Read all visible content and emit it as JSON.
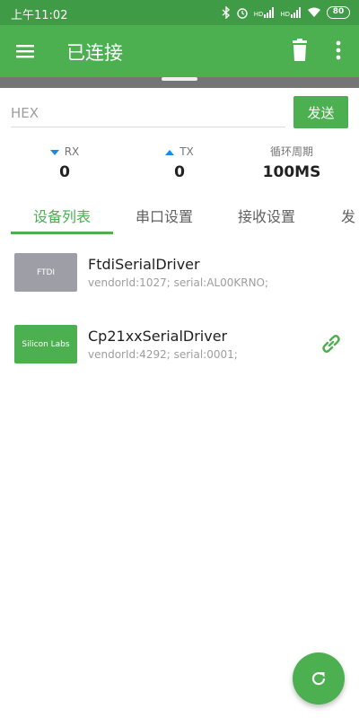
{
  "status_bar": {
    "time": "上午11:02",
    "battery": "80",
    "net_hd1": "HD",
    "net_hd2": "HD"
  },
  "app_bar": {
    "title": "已连接",
    "menu_icon": "menu-icon",
    "trash_icon": "trash-icon",
    "more_icon": "more-vert-icon"
  },
  "input": {
    "placeholder": "HEX",
    "value": "",
    "send_label": "发送"
  },
  "stats": {
    "rx_label": "RX",
    "rx_value": "0",
    "tx_label": "TX",
    "tx_value": "0",
    "period_label": "循环周期",
    "period_value": "100MS"
  },
  "tabs": [
    {
      "label": "设备列表",
      "active": true
    },
    {
      "label": "串口设置",
      "active": false
    },
    {
      "label": "接收设置",
      "active": false
    },
    {
      "label": "发",
      "active": false
    }
  ],
  "devices": [
    {
      "logo_text": "FTDI",
      "name": "FtdiSerialDriver",
      "info": "vendorId:1027; serial:AL00KRNO;",
      "logo_color": "#9e9ea6",
      "connected": false
    },
    {
      "logo_text": "Silicon Labs",
      "name": "Cp21xxSerialDriver",
      "info": "vendorId:4292; serial:0001;",
      "logo_color": "#4caf50",
      "connected": true,
      "link_icon": "link-icon"
    }
  ],
  "fab": {
    "icon": "refresh-icon"
  },
  "colors": {
    "primary": "#4caf50",
    "primary_dark": "#3f9b45",
    "indicator_blue": "#1e88e5"
  }
}
